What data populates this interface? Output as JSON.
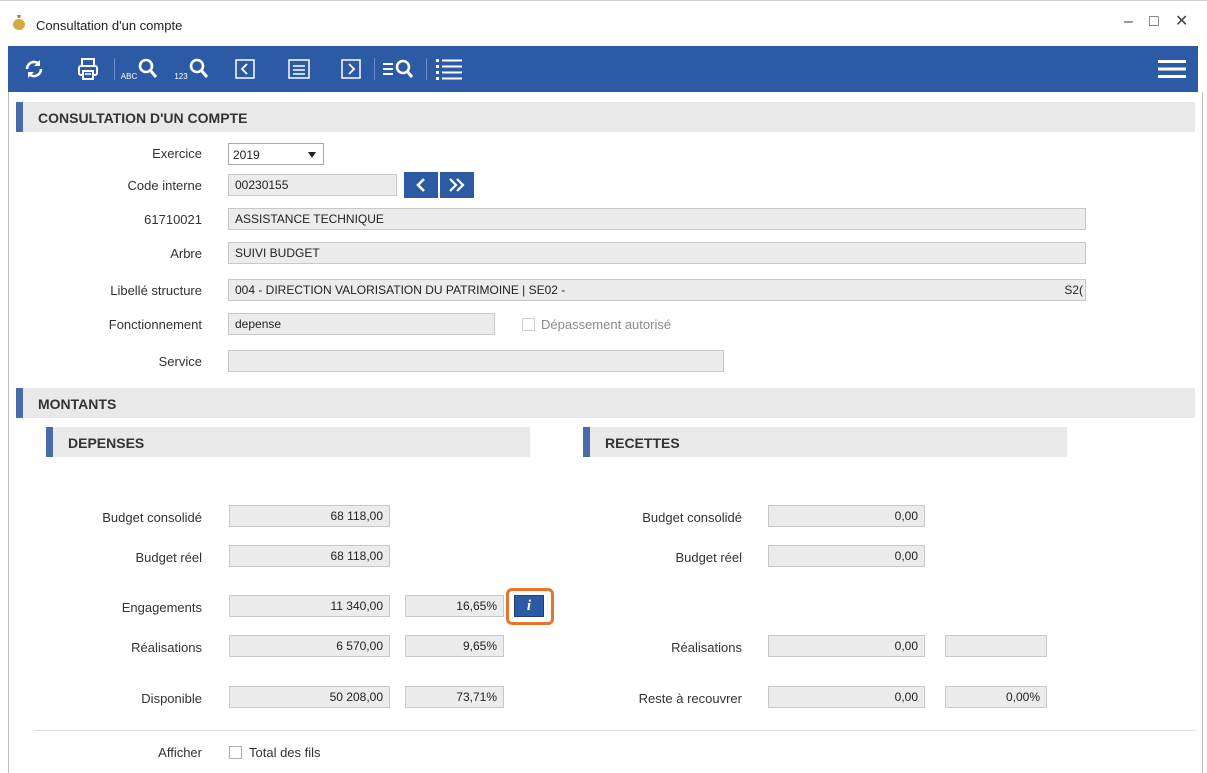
{
  "window": {
    "title": "Consultation d'un compte",
    "min": "–",
    "max": "□",
    "close": "✕"
  },
  "toolbar": {
    "abc_label": "ABC",
    "num_label": "123",
    "prev_symbol": "<",
    "next_symbol": ">"
  },
  "section_compte": {
    "title": "CONSULTATION D'UN COMPTE"
  },
  "form": {
    "exercice_label": "Exercice",
    "exercice_value": "2019",
    "code_interne_label": "Code interne",
    "code_interne_value": "00230155",
    "account_label": "61710021",
    "account_value": "ASSISTANCE TECHNIQUE",
    "arbre_label": "Arbre",
    "arbre_value": "SUIVI BUDGET",
    "structure_label": "Libellé structure",
    "structure_value": "004 - DIRECTION VALORISATION DU PATRIMOINE | SE02 -",
    "structure_suffix": "S2(",
    "fonctionnement_label": "Fonctionnement",
    "fonctionnement_value": "depense",
    "depassement_label": "Dépassement autorisé",
    "service_label": "Service",
    "service_value": ""
  },
  "section_montants": {
    "title": "MONTANTS"
  },
  "depenses": {
    "title": "DEPENSES",
    "budget_consolide_label": "Budget consolidé",
    "budget_consolide": "68 118,00",
    "budget_reel_label": "Budget réel",
    "budget_reel": "68 118,00",
    "engagements_label": "Engagements",
    "engagements": "11 340,00",
    "engagements_pct": "16,65%",
    "info_symbol": "i",
    "realisations_label": "Réalisations",
    "realisations": "6 570,00",
    "realisations_pct": "9,65%",
    "disponible_label": "Disponible",
    "disponible": "50 208,00",
    "disponible_pct": "73,71%"
  },
  "recettes": {
    "title": "RECETTES",
    "budget_consolide_label": "Budget consolidé",
    "budget_consolide": "0,00",
    "budget_reel_label": "Budget réel",
    "budget_reel": "0,00",
    "realisations_label": "Réalisations",
    "realisations": "0,00",
    "realisations_pct": "",
    "reste_label": "Reste à recouvrer",
    "reste": "0,00",
    "reste_pct": "0,00%"
  },
  "footer": {
    "afficher_label": "Afficher",
    "total_fils_label": "Total des fils"
  },
  "colors": {
    "toolbar": "#2d5aa5",
    "accent_bar": "#4a6aa9",
    "highlight": "#e8742a"
  }
}
